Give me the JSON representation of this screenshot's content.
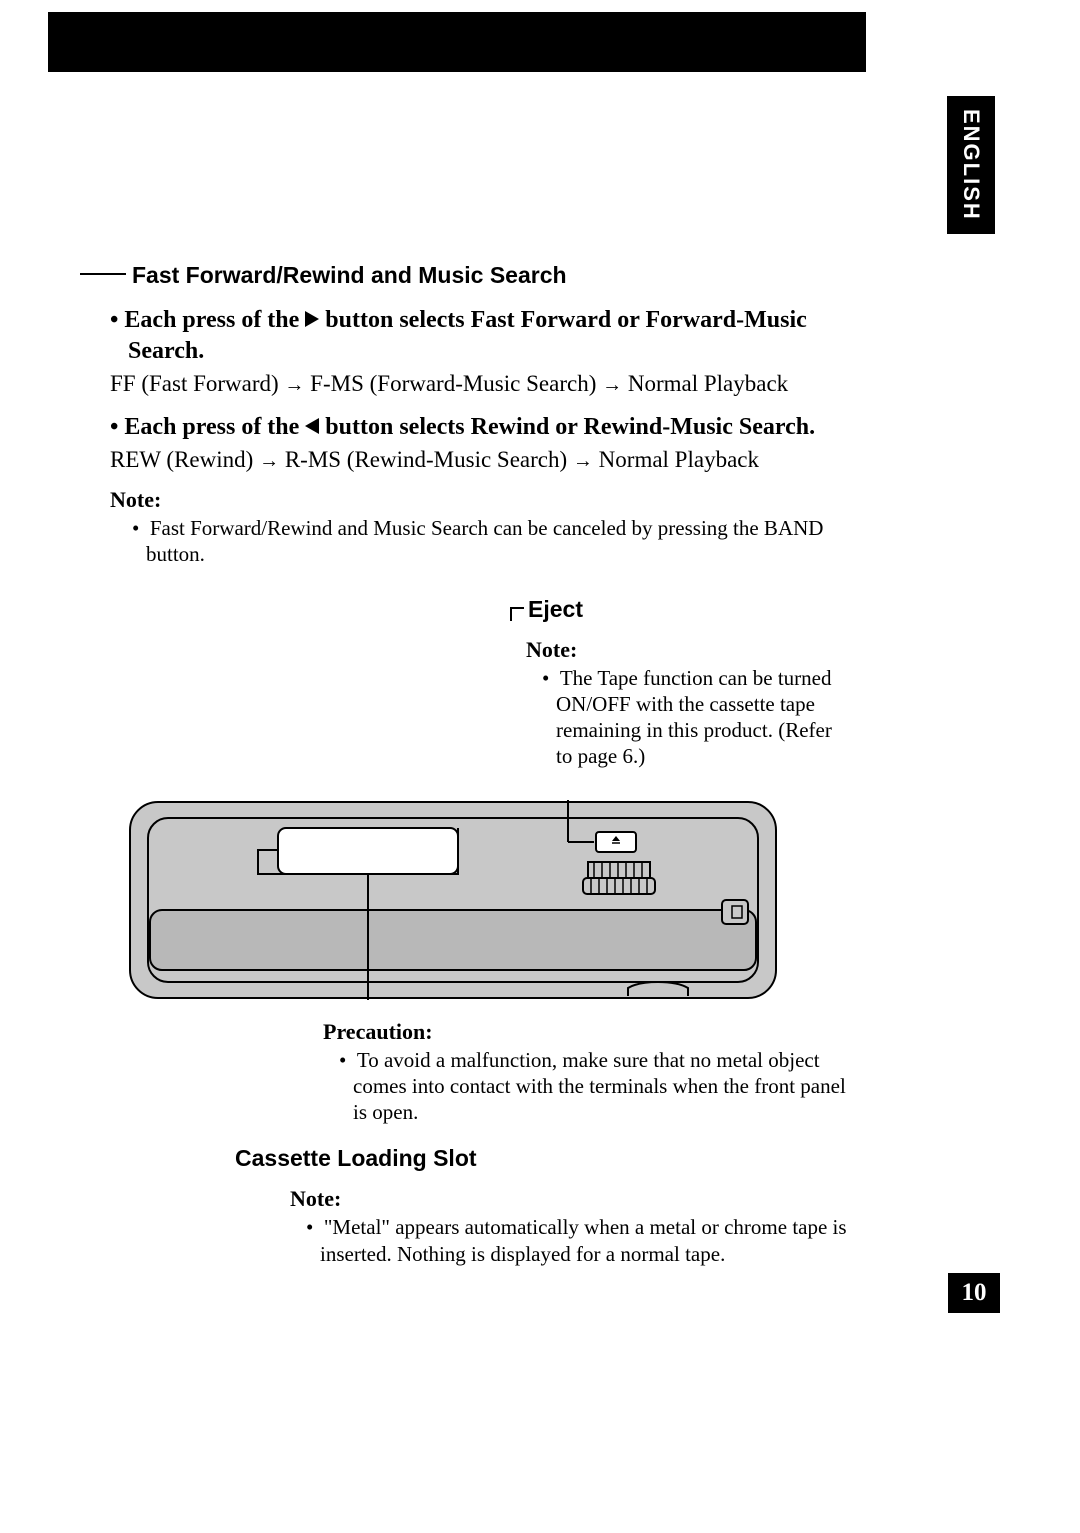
{
  "language_tab": "ENGLISH",
  "section1": {
    "heading": "Fast Forward/Rewind and Music Search",
    "bullet1": "Each press of the ▶ button selects Fast Forward or Forward-Music Search.",
    "bullet1_text_before": "Each press of the ",
    "bullet1_text_after": " button selects Fast Forward or Forward-Music Search.",
    "detail1_part1": "FF (Fast Forward) ",
    "detail1_part2": " F-MS (Forward-Music Search) ",
    "detail1_part3": " Normal Playback",
    "bullet2_text_before": "Each press of the ",
    "bullet2_text_after": " button selects Rewind or Rewind-Music Search.",
    "detail2_part1": "REW (Rewind) ",
    "detail2_part2": " R-MS (Rewind-Music Search) ",
    "detail2_part3": " Normal Playback",
    "note_label": "Note:",
    "note_text": "Fast Forward/Rewind and Music Search can be canceled by pressing the BAND button."
  },
  "eject": {
    "heading": "Eject",
    "note_label": "Note:",
    "note_text": "The Tape function can be turned ON/OFF with the cassette tape remaining in this product. (Refer to page 6.)"
  },
  "precaution": {
    "label": "Precaution:",
    "text": "To avoid a malfunction, make sure that no metal object comes into contact with the terminals when the front panel is open."
  },
  "cassette": {
    "heading": "Cassette Loading Slot",
    "note_label": "Note:",
    "note_text": "\"Metal\" appears automatically when a metal or chrome tape is inserted. Nothing is displayed for a normal tape."
  },
  "page_number": "10",
  "arrow_glyph": "→",
  "bullet_char": "•"
}
